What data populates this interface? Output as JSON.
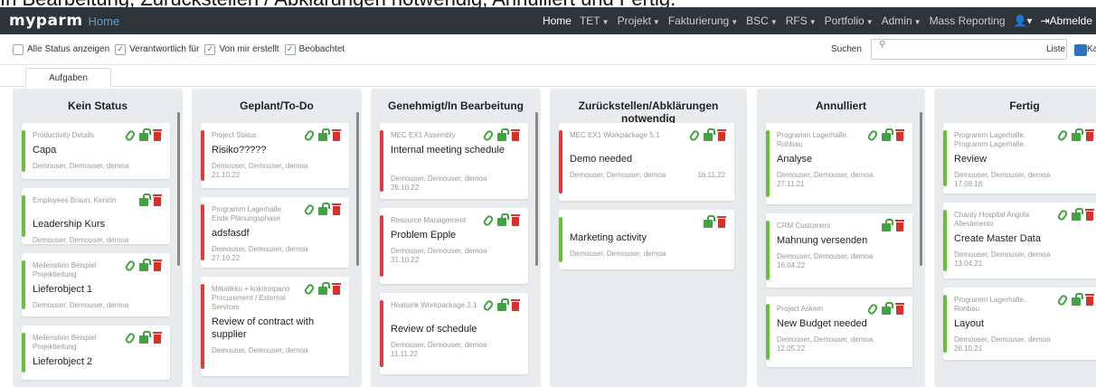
{
  "caption": "In Bearbeitung, Zurückstellen / Abklärungen notwendig, Annulliert und Fertig.",
  "navbar": {
    "logo": "myparm",
    "page": "Home",
    "items": [
      {
        "label": "Home",
        "caret": false,
        "active": true
      },
      {
        "label": "TET",
        "caret": true
      },
      {
        "label": "Projekt",
        "caret": true
      },
      {
        "label": "Fakturierung",
        "caret": true
      },
      {
        "label": "BSC",
        "caret": true
      },
      {
        "label": "RFS",
        "caret": true
      },
      {
        "label": "Portfolio",
        "caret": true
      },
      {
        "label": "Admin",
        "caret": true
      },
      {
        "label": "Mass Reporting",
        "caret": false
      }
    ],
    "user_icon": "user-icon",
    "logout_label": "Abmelde"
  },
  "filters": {
    "all_status": {
      "label": "Alle Status anzeigen",
      "checked": false
    },
    "responsible": {
      "label": "Verantwortlich für",
      "checked": true
    },
    "created_by_me": {
      "label": "Von mir erstellt",
      "checked": true
    },
    "observed": {
      "label": "Beobachtet",
      "checked": true
    },
    "search_label": "Suchen",
    "liste_label": "Liste",
    "kanban_label": "Kanb"
  },
  "tabs": {
    "active": "Aufgaben"
  },
  "columns": [
    {
      "title": "Kein Status",
      "cards": [
        {
          "project": "Productivity Details",
          "title": "Capa",
          "users": "Demouser, Demouser, demoa",
          "date": "",
          "color": "#6bbf3a",
          "clip": true
        },
        {
          "project": "Employees Braun, Kerstin",
          "title": "Leadership Kurs",
          "users": "Demouser, Demouser, demoa",
          "date": "",
          "color": "#6bbf3a",
          "clip": false
        },
        {
          "project": "Meilenstein Beispiel Projektleitung",
          "title": "Lieferobject 1",
          "users": "Demouser, Demouser, demoa",
          "date": "",
          "color": "#6bbf3a",
          "clip": true
        },
        {
          "project": "Meilenstein Beispiel Projektleitung",
          "title": "Lieferobject 2",
          "users": "",
          "date": "",
          "color": "#6bbf3a",
          "clip": true
        }
      ]
    },
    {
      "title": "Geplant/To-Do",
      "cards": [
        {
          "project": "Project Status",
          "title": "Risiko?????",
          "users": "Demouser, Demouser, demoa",
          "date": "21.10.22",
          "color": "#e03a3a",
          "clip": true
        },
        {
          "project": "Programm Lagerhalle. Ende Planungsphase",
          "title": "adsfasdf",
          "users": "Demouser, Demouser, demoa",
          "date": "27.10.22",
          "color": "#e03a3a",
          "clip": true
        },
        {
          "project": "Mittatikku + kokoonpano Procurement / External Services",
          "title": "Review of contract with supplier",
          "users": "Demouser, Demouser, demoa",
          "date": "",
          "color": "#e03a3a",
          "clip": true
        }
      ]
    },
    {
      "title": "Genehmigt/In Bearbeitung",
      "cards": [
        {
          "project": "MEC EX1 Assembly",
          "title": "Internal meeting schedule",
          "users": "Demouser, Demouser, demoa",
          "date": "26.10.22",
          "color": "#e03a3a",
          "clip": true
        },
        {
          "project": "Resource Management",
          "title": "Problem Epple",
          "users": "Demouser, Demouser, demoa",
          "date": "31.10.22",
          "color": "#e03a3a",
          "clip": true
        },
        {
          "project": "Heatsink Workpackage 2.1",
          "title": "Review of schedule",
          "users": "Demouser, Demouser, demoa",
          "date": "11.11.22",
          "color": "#e03a3a",
          "clip": true
        }
      ]
    },
    {
      "title": "Zurückstellen/Abklärungen notwendig",
      "cards": [
        {
          "project": "MEC EX1 Workpackage 5.1",
          "title": "Demo needed",
          "users": "Demouser, Demouser, demoa",
          "date": "16.11.22",
          "color": "#e03a3a",
          "clip": true
        },
        {
          "project": "",
          "title": "Marketing activity",
          "users": "Demouser, Demouser, demoa",
          "date": "",
          "color": "#6bbf3a",
          "clip": false
        }
      ]
    },
    {
      "title": "Annulliert",
      "cards": [
        {
          "project": "Programm Lagerhalle. Rohbau",
          "title": "Analyse",
          "users": "Demouser, Demouser, demoa",
          "date": "27.11.21",
          "color": "#6bbf3a",
          "clip": true
        },
        {
          "project": "CRM Customers",
          "title": "Mahnung versenden",
          "users": "Demouser, Demouser, demoa",
          "date": "16.04.22",
          "color": "#6bbf3a",
          "clip": false
        },
        {
          "project": "Project Askem",
          "title": "New Budget needed",
          "users": "Demouser, Demouser, demoa",
          "date": "12.05.22",
          "color": "#6bbf3a",
          "clip": true
        }
      ]
    },
    {
      "title": "Fertig",
      "cards": [
        {
          "project": "Programm Lagerhalle. Programm Lagerhalle.",
          "title": "Review",
          "users": "Demouser, Demouser, demoa",
          "date": "17.08.18",
          "color": "#6bbf3a",
          "clip": true
        },
        {
          "project": "Charity Hospital Angola Allestimento",
          "title": "Create Master Data",
          "users": "Demouser, Demouser, demoa",
          "date": "13.04.21",
          "color": "#6bbf3a",
          "clip": true
        },
        {
          "project": "Programm Lagerhalle. Rohbau",
          "title": "Layout",
          "users": "Demouser, Demouser, demoa",
          "date": "26.10.21",
          "color": "#6bbf3a",
          "clip": true
        }
      ]
    }
  ]
}
